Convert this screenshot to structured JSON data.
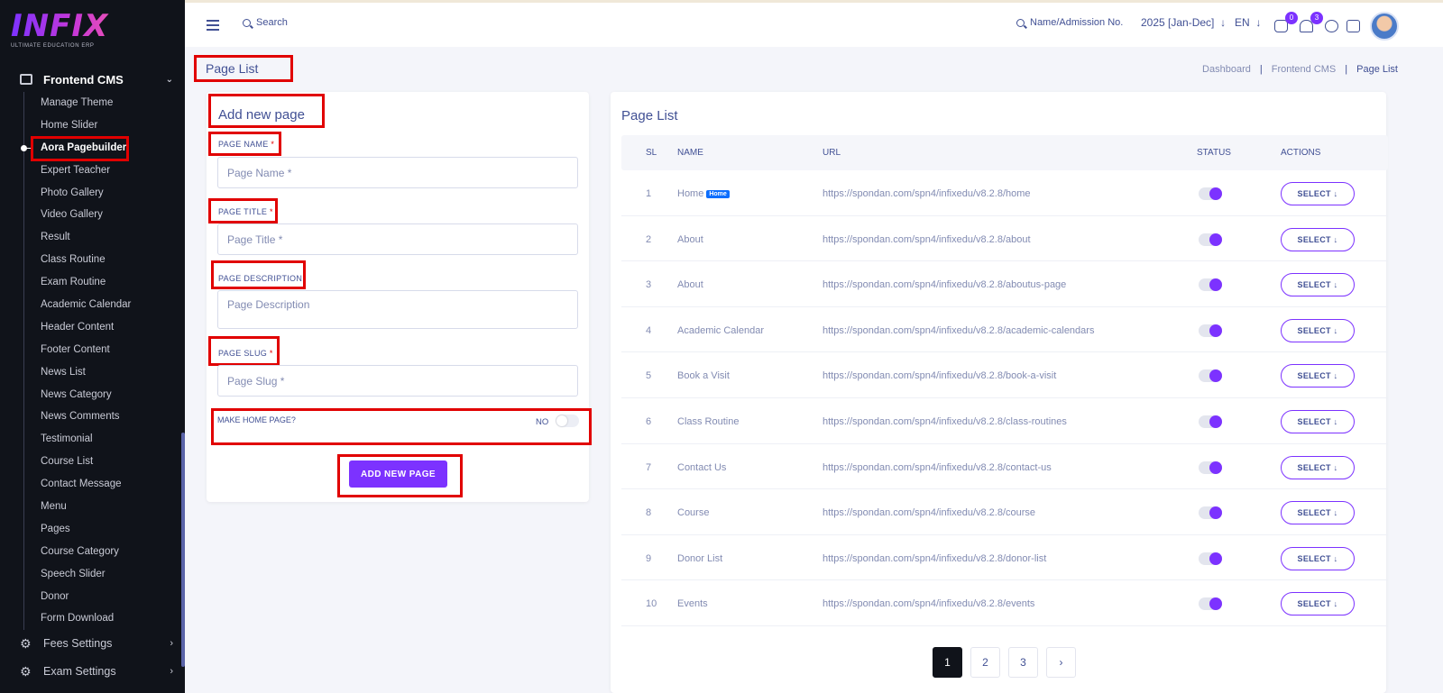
{
  "brand": {
    "name": "INFIX",
    "tagline": "ULTIMATE EDUCATION ERP"
  },
  "sidebar": {
    "section": "Frontend CMS",
    "items": [
      "Manage Theme",
      "Home Slider",
      "Aora Pagebuilder",
      "Expert Teacher",
      "Photo Gallery",
      "Video Gallery",
      "Result",
      "Class Routine",
      "Exam Routine",
      "Academic Calendar",
      "Header Content",
      "Footer Content",
      "News List",
      "News Category",
      "News Comments",
      "Testimonial",
      "Course List",
      "Contact Message",
      "Menu",
      "Pages",
      "Course Category",
      "Speech Slider",
      "Donor",
      "Form Download"
    ],
    "active_item": "Aora Pagebuilder",
    "bottom": [
      "Fees Settings",
      "Exam Settings"
    ]
  },
  "topbar": {
    "search_label": "Search",
    "admission_search": "Name/Admission No.",
    "year": "2025 [Jan-Dec]",
    "language": "EN",
    "chat_count": "0",
    "notification_count": "3"
  },
  "page": {
    "title": "Page List",
    "breadcrumb": [
      "Dashboard",
      "Frontend CMS",
      "Page List"
    ]
  },
  "form": {
    "title": "Add new page",
    "page_name_label": "PAGE NAME",
    "page_name_placeholder": "Page Name *",
    "page_title_label": "PAGE TITLE",
    "page_title_placeholder": "Page Title *",
    "page_description_label": "PAGE DESCRIPTION",
    "page_description_placeholder": "Page Description",
    "page_slug_label": "PAGE SLUG",
    "page_slug_placeholder": "Page Slug *",
    "required_mark": "*",
    "make_home_label": "MAKE HOME PAGE?",
    "make_home_value": "NO",
    "submit_label": "ADD NEW PAGE"
  },
  "table": {
    "title": "Page List",
    "columns": [
      "SL",
      "NAME",
      "URL",
      "STATUS",
      "ACTIONS"
    ],
    "home_badge": "Home",
    "action_label": "SELECT",
    "rows": [
      {
        "sl": "1",
        "name": "Home",
        "url": "https://spondan.com/spn4/infixedu/v8.2.8/home"
      },
      {
        "sl": "2",
        "name": "About",
        "url": "https://spondan.com/spn4/infixedu/v8.2.8/about"
      },
      {
        "sl": "3",
        "name": "About",
        "url": "https://spondan.com/spn4/infixedu/v8.2.8/aboutus-page"
      },
      {
        "sl": "4",
        "name": "Academic Calendar",
        "url": "https://spondan.com/spn4/infixedu/v8.2.8/academic-calendars"
      },
      {
        "sl": "5",
        "name": "Book a Visit",
        "url": "https://spondan.com/spn4/infixedu/v8.2.8/book-a-visit"
      },
      {
        "sl": "6",
        "name": "Class Routine",
        "url": "https://spondan.com/spn4/infixedu/v8.2.8/class-routines"
      },
      {
        "sl": "7",
        "name": "Contact Us",
        "url": "https://spondan.com/spn4/infixedu/v8.2.8/contact-us"
      },
      {
        "sl": "8",
        "name": "Course",
        "url": "https://spondan.com/spn4/infixedu/v8.2.8/course"
      },
      {
        "sl": "9",
        "name": "Donor List",
        "url": "https://spondan.com/spn4/infixedu/v8.2.8/donor-list"
      },
      {
        "sl": "10",
        "name": "Events",
        "url": "https://spondan.com/spn4/infixedu/v8.2.8/events"
      }
    ]
  },
  "pagination": [
    "1",
    "2",
    "3"
  ],
  "colors": {
    "accent": "#7c32ff",
    "sidebar": "#10131a",
    "text": "#415094",
    "annotation": "#e10000"
  }
}
